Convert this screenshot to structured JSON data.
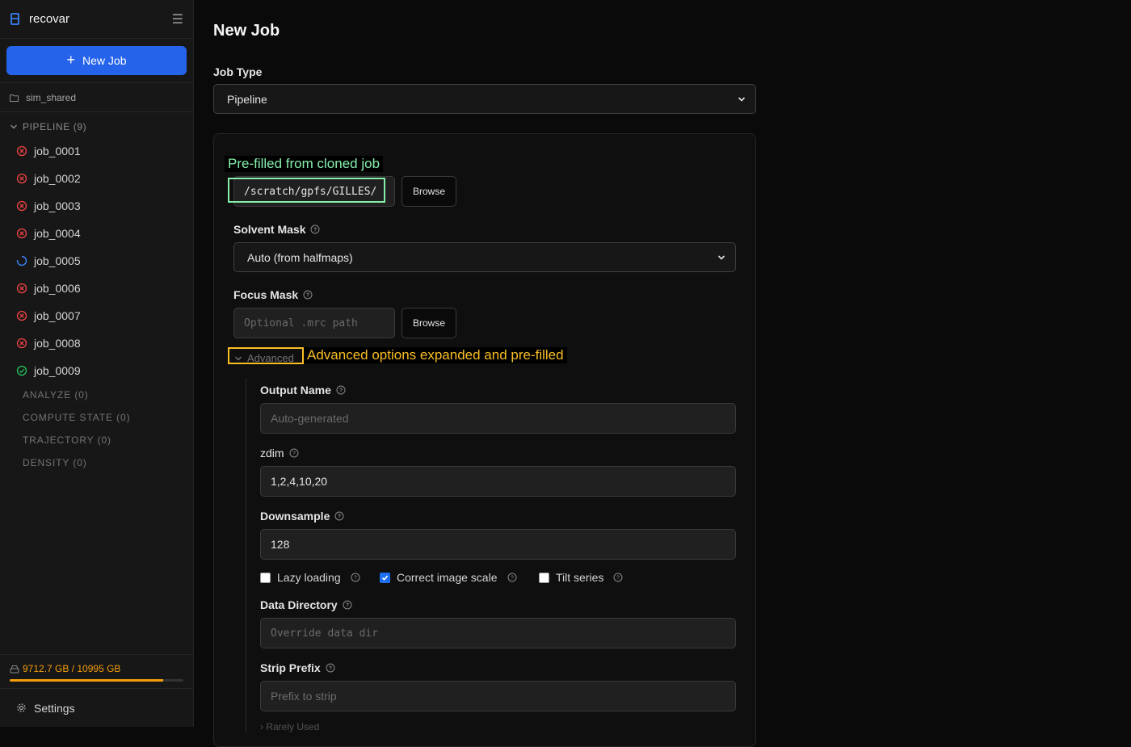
{
  "app": {
    "name": "recovar"
  },
  "sidebar": {
    "new_job_label": "New Job",
    "project": "sim_shared",
    "pipeline_group": "PIPELINE (9)",
    "jobs": [
      {
        "name": "job_0001",
        "status": "failed"
      },
      {
        "name": "job_0002",
        "status": "failed"
      },
      {
        "name": "job_0003",
        "status": "failed"
      },
      {
        "name": "job_0004",
        "status": "failed"
      },
      {
        "name": "job_0005",
        "status": "running"
      },
      {
        "name": "job_0006",
        "status": "failed"
      },
      {
        "name": "job_0007",
        "status": "failed"
      },
      {
        "name": "job_0008",
        "status": "failed"
      },
      {
        "name": "job_0009",
        "status": "completed"
      }
    ],
    "other_groups": [
      "ANALYZE (0)",
      "COMPUTE STATE (0)",
      "TRAJECTORY (0)",
      "DENSITY (0)"
    ],
    "storage": {
      "text": "9712.7 GB / 10995 GB",
      "fraction": 0.883
    },
    "settings_label": "Settings"
  },
  "form": {
    "title": "New Job",
    "job_type_label": "Job Type",
    "job_type_value": "Pipeline",
    "particles_path": "/scratch/gpfs/GILLES/",
    "browse_label": "Browse",
    "solvent_mask_label": "Solvent Mask",
    "solvent_mask_value": "Auto (from halfmaps)",
    "focus_mask_label": "Focus Mask",
    "focus_mask_placeholder": "Optional .mrc path",
    "advanced_label": "Advanced",
    "output_name_label": "Output Name",
    "output_name_placeholder": "Auto-generated",
    "zdim_label": "zdim",
    "zdim_value": "1,2,4,10,20",
    "downsample_label": "Downsample",
    "downsample_value": "128",
    "lazy_loading_label": "Lazy loading",
    "lazy_loading_checked": false,
    "correct_scale_label": "Correct image scale",
    "correct_scale_checked": true,
    "tilt_series_label": "Tilt series",
    "tilt_series_checked": false,
    "data_dir_label": "Data Directory",
    "data_dir_placeholder": "Override data dir",
    "strip_prefix_label": "Strip Prefix",
    "strip_prefix_placeholder": "Prefix to strip",
    "rarely_used_label": "Rarely Used"
  },
  "annotations": {
    "prefilled": "Pre-filled from cloned job",
    "advanced": "Advanced options expanded and pre-filled"
  },
  "colors": {
    "accent": "#2563eb",
    "failed": "#ef4444",
    "running": "#3b82f6",
    "completed": "#22c55e",
    "warning": "#f59e0b",
    "annotation_green": "#86efac",
    "annotation_yellow": "#fbbf24"
  }
}
